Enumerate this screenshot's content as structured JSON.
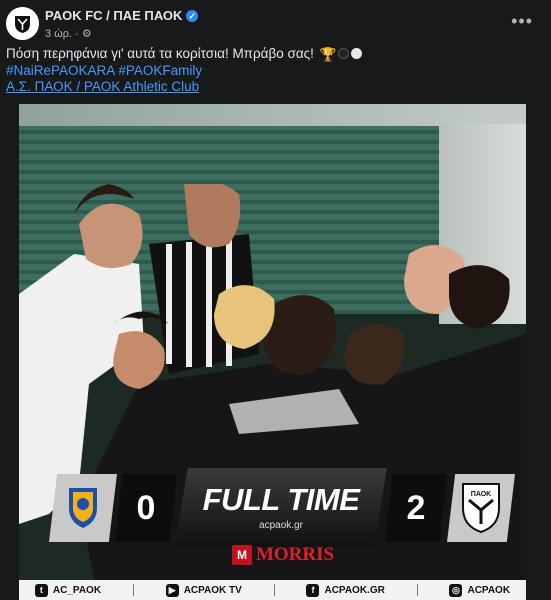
{
  "post": {
    "page_name": "PAOK FC / ΠΑΕ ΠΑΟΚ",
    "time": "3 ώρ.",
    "privacy_icon": "gear-icon",
    "more_label": "•••",
    "text_line": "Πόση περηφάνια γι' αυτά τα κορίτσια! Μπράβο σας!",
    "hashtags": [
      "#NaiRePAOKARA",
      "#PAOKFamily"
    ],
    "club_link": "Α.Σ. ΠΑΟΚ / PAOK Athletic Club"
  },
  "graphic": {
    "home_score": "0",
    "away_score": "2",
    "status": "FULL TIME",
    "site": "acpaok.gr",
    "sponsor": "MORRIS",
    "away_crest_text": "ΠΑΟΚ",
    "socials": [
      {
        "icon": "twitter-icon",
        "label": "AC_PAOK"
      },
      {
        "icon": "youtube-icon",
        "label": "ACPAOK TV"
      },
      {
        "icon": "facebook-icon",
        "label": "ACPAOK.GR"
      },
      {
        "icon": "instagram-icon",
        "label": "ACPAOK"
      }
    ]
  },
  "colors": {
    "background": "#18191a",
    "link": "#4599ff",
    "verified": "#2d88ff",
    "sponsor_red": "#e01f2a"
  }
}
